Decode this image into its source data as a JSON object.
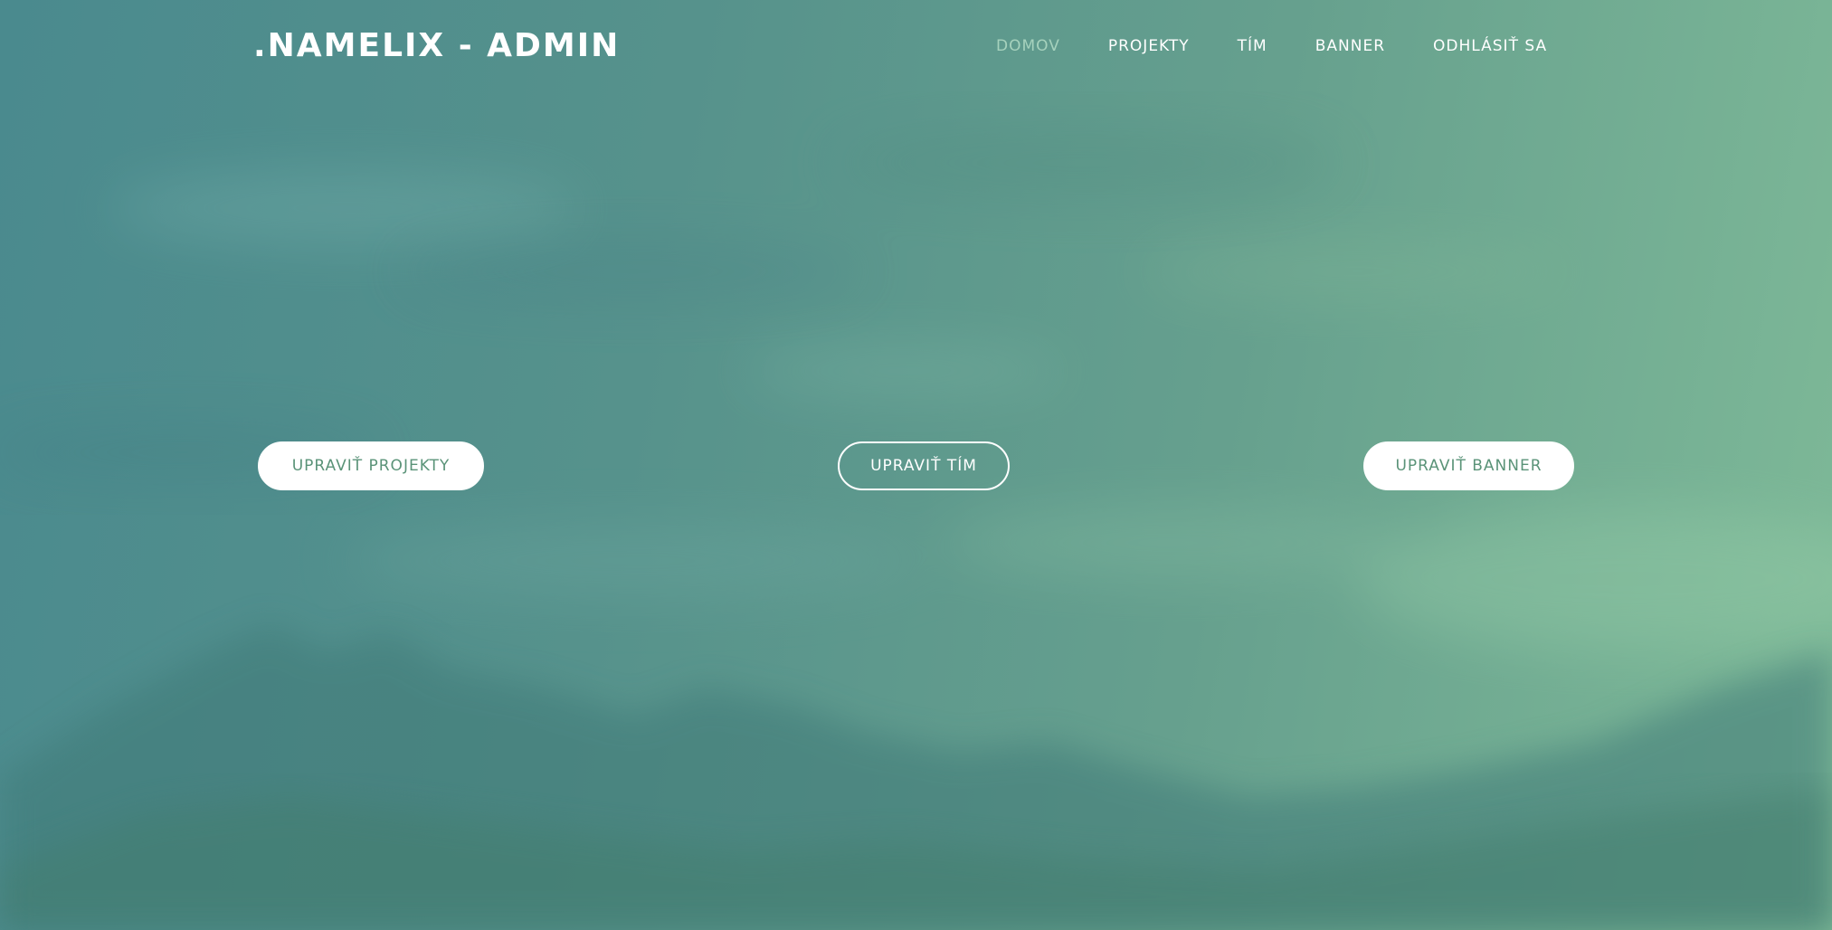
{
  "brand": {
    "title": ".NAMELIX - ADMIN"
  },
  "nav": {
    "items": [
      {
        "label": "DOMOV",
        "active": true
      },
      {
        "label": "PROJEKTY",
        "active": false
      },
      {
        "label": "TÍM",
        "active": false
      },
      {
        "label": "BANNER",
        "active": false
      },
      {
        "label": "ODHLÁSIŤ SA",
        "active": false
      }
    ]
  },
  "actions": {
    "edit_projects": "UPRAVIŤ PROJEKTY",
    "edit_team": "UPRAVIŤ TÍM",
    "edit_banner": "UPRAVIŤ BANNER"
  },
  "colors": {
    "overlay_left": "#4a8a8e",
    "overlay_right": "#7fba98",
    "active_nav": "#a6d2bd",
    "button_text": "#5a9378"
  }
}
